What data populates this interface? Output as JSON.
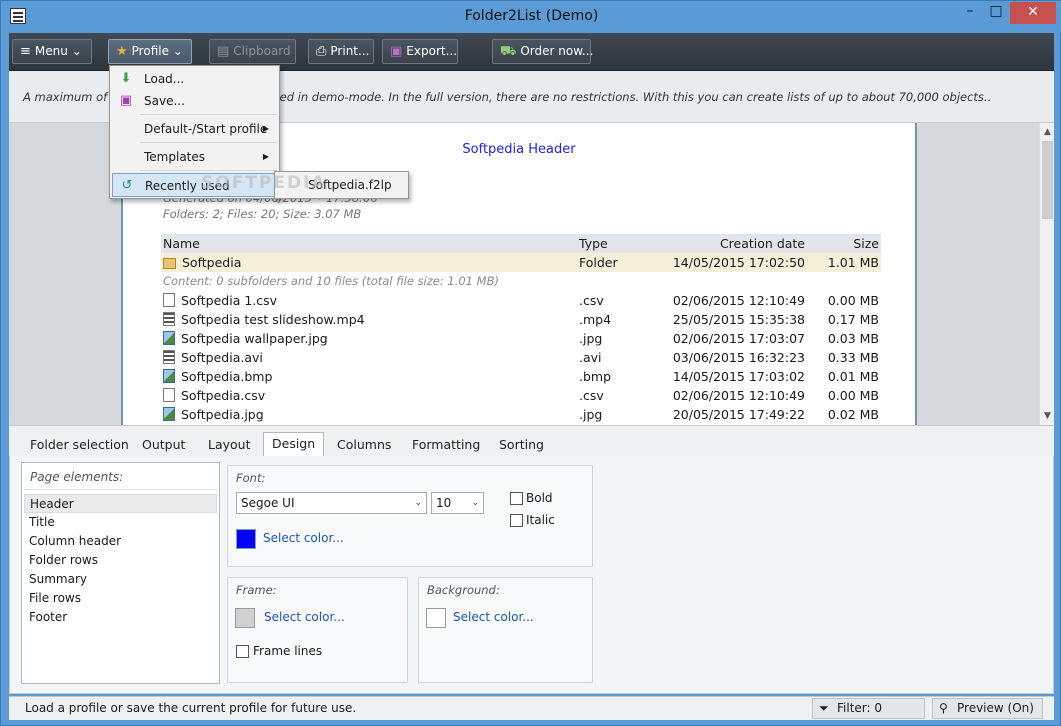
{
  "window": {
    "title": "Folder2List (Demo)",
    "minimize": "–",
    "maximize": "□",
    "close": "✕"
  },
  "toolbar": {
    "menu_label": "Menu",
    "profile_label": "Profile",
    "clipboard_label": "Clipboard",
    "print_label": "Print...",
    "export_label": "Export...",
    "order_label": "Order now..."
  },
  "notice": "A maximum of 10 files per folder are displayed in demo-mode. In the full version, there are no restrictions. With this you can create lists of up to about 70,000 objects..",
  "profile_menu": {
    "load": "Load...",
    "save": "Save...",
    "default_start": "Default-/Start profile",
    "templates": "Templates",
    "recently_used": "Recently used",
    "recent_item": "Softpedia.f2lp"
  },
  "preview": {
    "header": "Softpedia Header",
    "generated": "Generated on 04/06/2015 • 17:38:06",
    "summary": "Folders: 2;  Files: 20;  Size: 3.07 MB",
    "columns": [
      "Name",
      "Type",
      "Creation date",
      "Size"
    ],
    "folder_row": {
      "name": "Softpedia",
      "type": "Folder",
      "date": "14/05/2015 17:02:50",
      "size": "1.01 MB"
    },
    "folder_content": "Content: 0 subfolders and 10 files (total file size: 1.01 MB)",
    "files": [
      {
        "name": "Softpedia 1.csv",
        "type": ".csv",
        "date": "02/06/2015 12:10:49",
        "size": "0.00 MB",
        "icon": "file-icon"
      },
      {
        "name": "Softpedia test slideshow.mp4",
        "type": ".mp4",
        "date": "25/05/2015 15:35:38",
        "size": "0.17 MB",
        "icon": "video-icon"
      },
      {
        "name": "Softpedia wallpaper.jpg",
        "type": ".jpg",
        "date": "02/06/2015 17:03:07",
        "size": "0.03 MB",
        "icon": "image-icon"
      },
      {
        "name": "Softpedia.avi",
        "type": ".avi",
        "date": "03/06/2015 16:32:23",
        "size": "0.33 MB",
        "icon": "video-icon"
      },
      {
        "name": "Softpedia.bmp",
        "type": ".bmp",
        "date": "14/05/2015 17:03:02",
        "size": "0.01 MB",
        "icon": "image-icon"
      },
      {
        "name": "Softpedia.csv",
        "type": ".csv",
        "date": "02/06/2015 12:10:49",
        "size": "0.00 MB",
        "icon": "file-icon"
      },
      {
        "name": "Softpedia.jpg",
        "type": ".jpg",
        "date": "20/05/2015 17:49:22",
        "size": "0.02 MB",
        "icon": "image-icon"
      }
    ]
  },
  "watermark": "SOFTPEDIA",
  "tabs": [
    "Folder selection",
    "Output",
    "Layout",
    "Design",
    "Columns",
    "Formatting",
    "Sorting"
  ],
  "active_tab": "Design",
  "design": {
    "page_elements_caption": "Page elements:",
    "page_elements": [
      "Header",
      "Title",
      "Column header",
      "Folder rows",
      "Summary",
      "File rows",
      "Footer"
    ],
    "selected_element": "Header",
    "font_caption": "Font:",
    "font_name": "Segoe UI",
    "font_size": "10",
    "bold_label": "Bold",
    "italic_label": "Italic",
    "select_color": "Select color...",
    "font_color": "#0000ff",
    "frame_caption": "Frame:",
    "frame_color": "#d0d0d0",
    "frame_lines_label": "Frame lines",
    "background_caption": "Background:",
    "background_color": "#ffffff"
  },
  "status": {
    "text": "Load a profile or save the current profile for future use.",
    "filter": "Filter: 0",
    "preview": "Preview (On)"
  }
}
